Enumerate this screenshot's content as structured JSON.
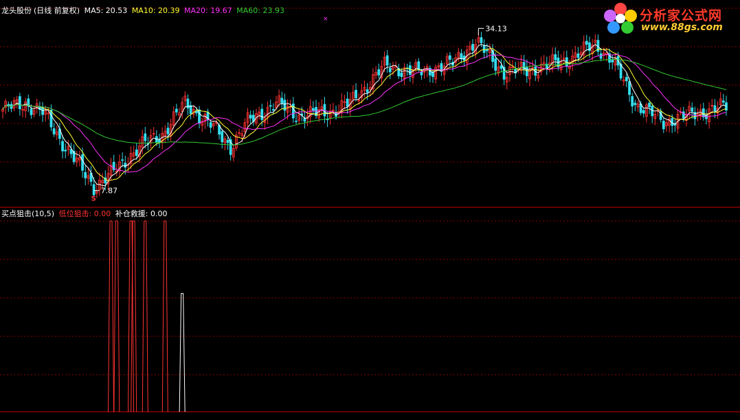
{
  "main_panel": {
    "stock_name": "龙头股份",
    "period": "(日线 前复权)",
    "indicators": [
      {
        "label": "MA5: 20.53",
        "color": "#ffffff"
      },
      {
        "label": "MA10: 20.39",
        "color": "#ffff33"
      },
      {
        "label": "MA20: 19.67",
        "color": "#ff33ff"
      },
      {
        "label": "MA60: 23.93",
        "color": "#33cc33"
      }
    ]
  },
  "sub_panel": {
    "indicator_name": "买点狙击(10,5)",
    "indicators": [
      {
        "label": "低位狙击: 0.00",
        "color": "#ff3333"
      },
      {
        "label": "补仓救援: 0.00",
        "color": "#ffffff"
      }
    ]
  },
  "logo": {
    "text_cn": "分析家公式网",
    "text_url": "www.88gs.com"
  },
  "colors": {
    "background": "#000000",
    "up_candle": "#ff3333",
    "down_candle": "#33ddee",
    "grid": "#8b0000",
    "ma5": "#ffffff",
    "ma10": "#ffff33",
    "ma20": "#ff33ff",
    "ma60": "#33cc33",
    "signal_low": "#ff3333",
    "signal_rescue": "#ffffff"
  },
  "chart_data": [
    {
      "type": "candlestick",
      "series_names": [
        "MA5",
        "MA10",
        "MA20",
        "MA60"
      ],
      "marked_high": {
        "label": "34.13",
        "value": 34.13
      },
      "marked_low": {
        "label": "7.87",
        "value": 7.87
      },
      "signal_marker": "S",
      "price_range": [
        6.5,
        36.5
      ],
      "keypoints": [
        {
          "i": 0,
          "p": 21.0
        },
        {
          "i": 8,
          "p": 22.0
        },
        {
          "i": 14,
          "p": 20.5
        },
        {
          "i": 22,
          "p": 15.0
        },
        {
          "i": 32,
          "p": 8.5
        },
        {
          "i": 38,
          "p": 10.5
        },
        {
          "i": 48,
          "p": 15.0
        },
        {
          "i": 56,
          "p": 17.0
        },
        {
          "i": 64,
          "p": 22.0
        },
        {
          "i": 72,
          "p": 19.0
        },
        {
          "i": 80,
          "p": 15.0
        },
        {
          "i": 86,
          "p": 19.0
        },
        {
          "i": 96,
          "p": 22.0
        },
        {
          "i": 104,
          "p": 20.0
        },
        {
          "i": 114,
          "p": 20.5
        },
        {
          "i": 122,
          "p": 22.0
        },
        {
          "i": 134,
          "p": 28.0
        },
        {
          "i": 146,
          "p": 27.0
        },
        {
          "i": 158,
          "p": 28.5
        },
        {
          "i": 166,
          "p": 32.0
        },
        {
          "i": 176,
          "p": 27.0
        },
        {
          "i": 186,
          "p": 27.5
        },
        {
          "i": 198,
          "p": 29.0
        },
        {
          "i": 208,
          "p": 31.5
        },
        {
          "i": 214,
          "p": 29.0
        },
        {
          "i": 222,
          "p": 22.0
        },
        {
          "i": 232,
          "p": 19.0
        },
        {
          "i": 244,
          "p": 20.5
        },
        {
          "i": 254,
          "p": 21.5
        }
      ],
      "candle_count": 255
    },
    {
      "type": "spike",
      "series": [
        {
          "name": "低位狙击",
          "color_key": "signal_low",
          "spikes": [
            {
              "i": 38,
              "value": 1.0
            },
            {
              "i": 40,
              "value": 1.0
            },
            {
              "i": 45,
              "value": 1.0
            },
            {
              "i": 46,
              "value": 1.0
            },
            {
              "i": 50,
              "value": 1.0
            },
            {
              "i": 57,
              "value": 1.0
            }
          ]
        },
        {
          "name": "补仓救援",
          "color_key": "signal_rescue",
          "spikes": [
            {
              "i": 63,
              "value": 0.62
            }
          ]
        }
      ]
    }
  ]
}
